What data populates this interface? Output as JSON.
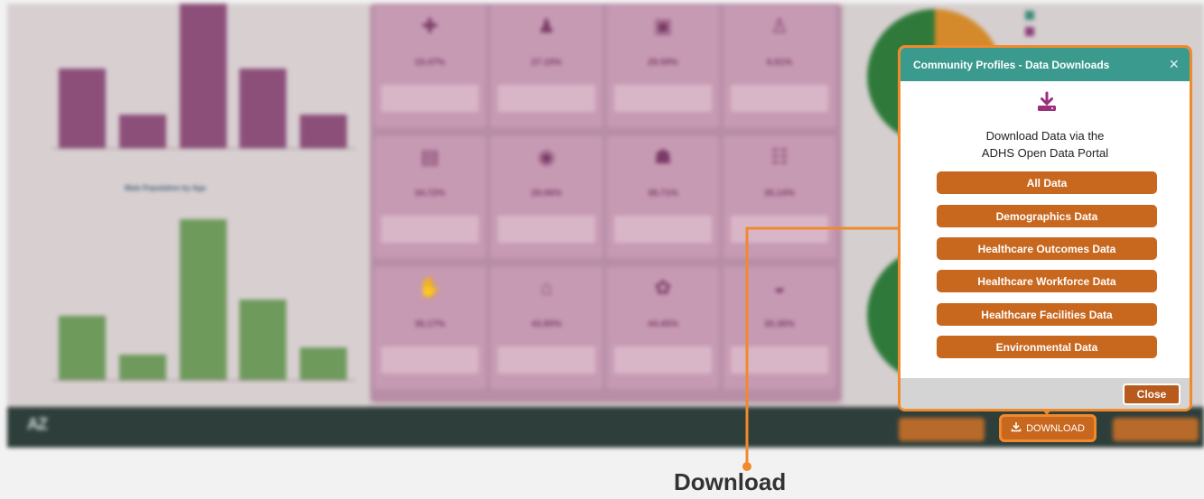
{
  "background": {
    "logo_text": "AZ",
    "chart_title": "Male Population by Age",
    "left_charts": {
      "top_bars": [
        {
          "value_label": "",
          "height": 0.55
        },
        {
          "value_label": "",
          "height": 0.23
        },
        {
          "value_label": "",
          "height": 1.0
        },
        {
          "value_label": "",
          "height": 0.55
        },
        {
          "value_label": "",
          "height": 0.23
        }
      ],
      "bottom_bars": [
        {
          "value_label": "",
          "height": 0.4
        },
        {
          "value_label": "",
          "height": 0.16
        },
        {
          "value_label": "",
          "height": 1.0
        },
        {
          "value_label": "",
          "height": 0.5
        },
        {
          "value_label": "",
          "height": 0.2
        }
      ]
    },
    "tiles": [
      {
        "icon": "dr-icon",
        "percent": "19.47%"
      },
      {
        "icon": "person-icon",
        "percent": "27.10%"
      },
      {
        "icon": "card-icon",
        "percent": "29.59%"
      },
      {
        "icon": "figure-icon",
        "percent": "6.91%"
      },
      {
        "icon": "money-icon",
        "percent": "34.72%"
      },
      {
        "icon": "coins-icon",
        "percent": "29.06%"
      },
      {
        "icon": "family-icon",
        "percent": "38.71%"
      },
      {
        "icon": "group-icon",
        "percent": "35.14%"
      },
      {
        "icon": "hands-icon",
        "percent": "36.17%"
      },
      {
        "icon": "house-icon",
        "percent": "43.80%"
      },
      {
        "icon": "badge-icon",
        "percent": "44.45%"
      },
      {
        "icon": "basket-icon",
        "percent": "30.36%"
      }
    ],
    "colors": {
      "accent_orange": "#c8671e",
      "highlight_orange": "#f08a2c",
      "teal_header": "#3a9a8e",
      "footer_dark": "#2e3e3a"
    }
  },
  "modal": {
    "title": "Community Profiles - Data Downloads",
    "close_x": "×",
    "icon": "download-icon",
    "heading_line1": "Download Data via the",
    "heading_line2": "ADHS Open Data Portal",
    "buttons": [
      "All Data",
      "Demographics Data",
      "Healthcare Outcomes Data",
      "Healthcare Workforce Data",
      "Healthcare Facilities Data",
      "Environmental Data"
    ],
    "close_label": "Close"
  },
  "toolbar": {
    "download_label": "DOWNLOAD",
    "download_icon": "download-icon"
  },
  "callout": {
    "label": "Download"
  }
}
